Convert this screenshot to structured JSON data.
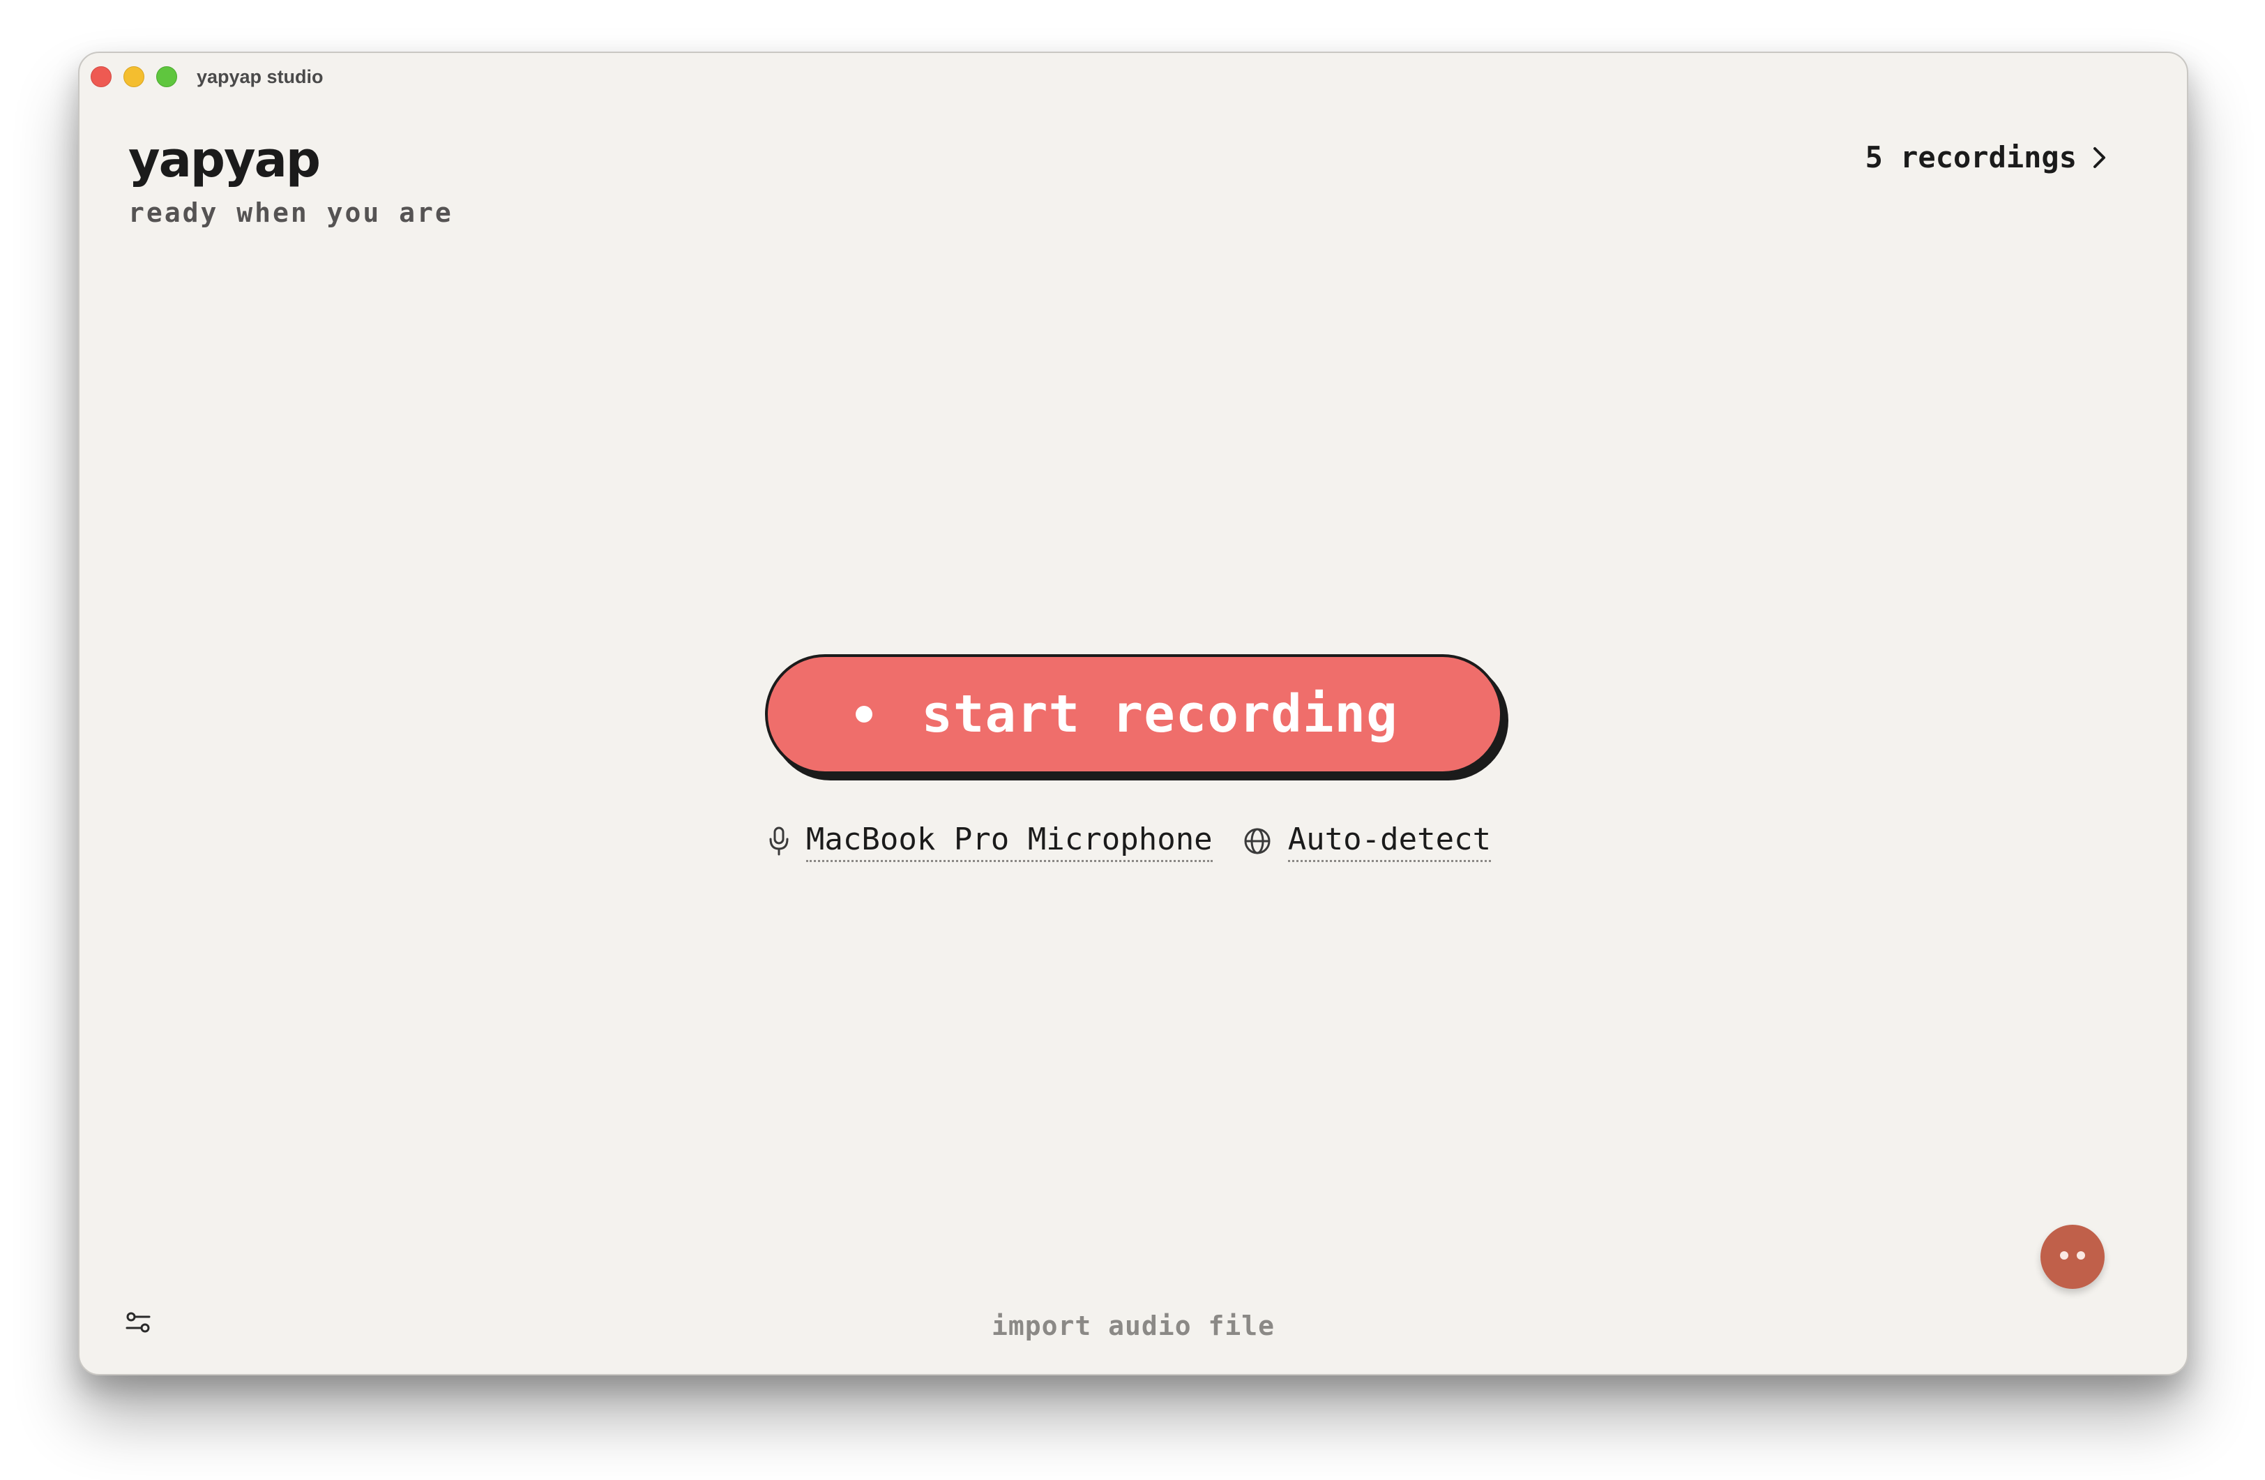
{
  "window": {
    "title": "yapyap studio"
  },
  "header": {
    "brand": "yapyap",
    "tagline": "ready when you are",
    "recordings_link": "5 recordings",
    "recordings_icon": "chevron-right-icon"
  },
  "main": {
    "record_button_label": "start recording",
    "record_color": "#ef6e6b",
    "input_device": "MacBook Pro Microphone",
    "input_device_icon": "microphone-icon",
    "language": "Auto-detect",
    "language_icon": "globe-icon"
  },
  "footer": {
    "import_label": "import audio file",
    "settings_icon": "sliders-icon",
    "mascot_icon": "mascot-face-icon",
    "mascot_color": "#c0604a"
  }
}
